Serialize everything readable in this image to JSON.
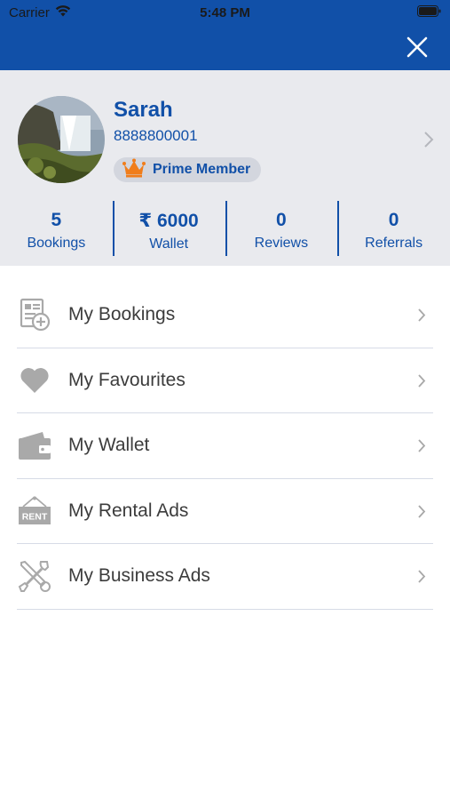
{
  "status_bar": {
    "carrier": "Carrier",
    "time": "5:48 PM"
  },
  "header": {
    "close_icon": "close-icon",
    "background": "#1150a8"
  },
  "profile": {
    "name": "Sarah",
    "phone": "8888800001",
    "badge": {
      "label": "Prime Member",
      "icon": "crown-icon"
    }
  },
  "stats": [
    {
      "value": "5",
      "label": "Bookings"
    },
    {
      "value": "₹ 6000",
      "label": "Wallet"
    },
    {
      "value": "0",
      "label": "Reviews"
    },
    {
      "value": "0",
      "label": "Referrals"
    }
  ],
  "menu": [
    {
      "label": "My Bookings",
      "icon": "bookings-icon"
    },
    {
      "label": "My Favourites",
      "icon": "heart-icon"
    },
    {
      "label": "My Wallet",
      "icon": "wallet-icon"
    },
    {
      "label": "My Rental Ads",
      "icon": "rent-sign-icon",
      "icon_text": "RENT"
    },
    {
      "label": "My Business Ads",
      "icon": "tools-icon"
    }
  ],
  "colors": {
    "primary": "#1150a8",
    "profile_bg": "#e9eaee",
    "crown": "#f07d1b",
    "icon_gray": "#a9a9a9"
  }
}
